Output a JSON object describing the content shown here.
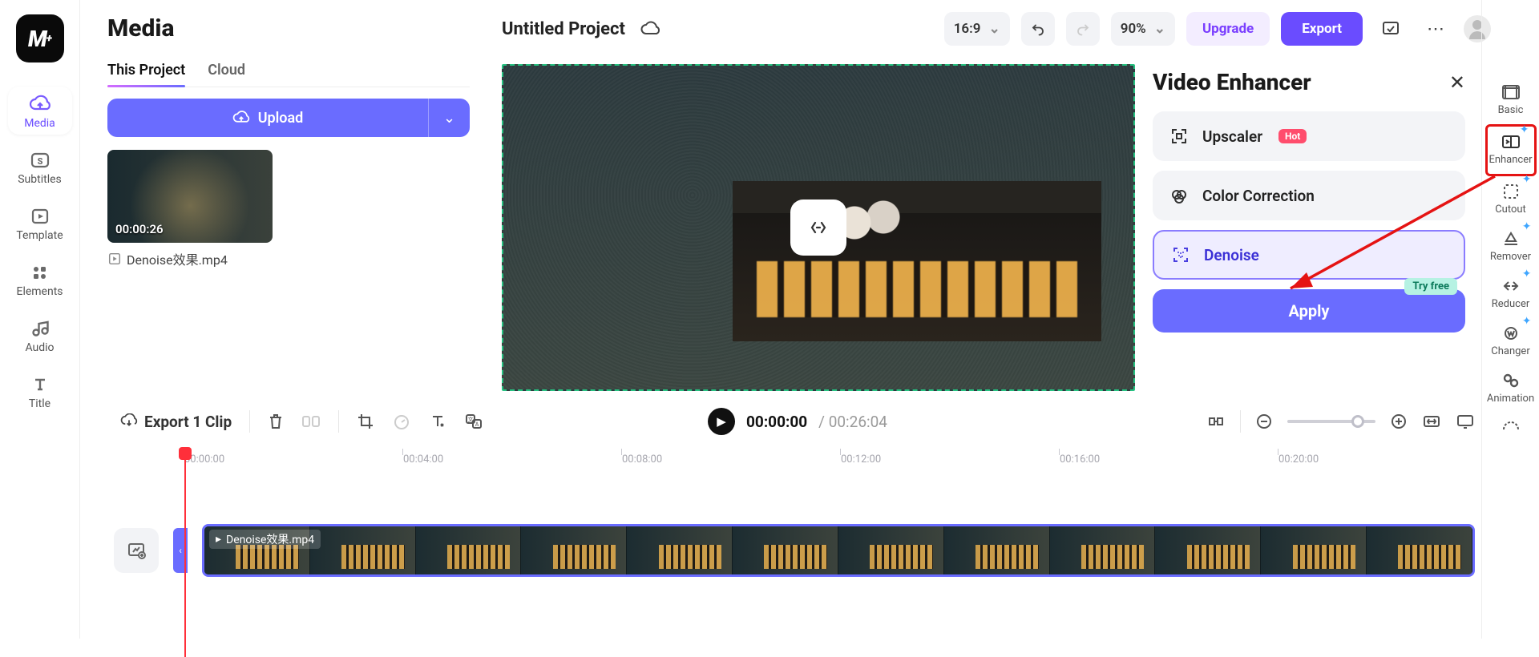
{
  "nav": {
    "items": [
      {
        "label": "Media"
      },
      {
        "label": "Subtitles"
      },
      {
        "label": "Template"
      },
      {
        "label": "Elements"
      },
      {
        "label": "Audio"
      },
      {
        "label": "Title"
      }
    ]
  },
  "mediaPanel": {
    "title": "Media",
    "tabs": {
      "thisProject": "This Project",
      "cloud": "Cloud"
    },
    "uploadLabel": "Upload",
    "clip": {
      "duration": "00:00:26",
      "filename": "Denoise效果.mp4"
    }
  },
  "top": {
    "project": "Untitled Project",
    "aspect": "16:9",
    "zoom": "90%",
    "upgrade": "Upgrade",
    "export": "Export"
  },
  "enhancer": {
    "title": "Video Enhancer",
    "upscaler": "Upscaler",
    "hot": "Hot",
    "color": "Color Correction",
    "denoise": "Denoise",
    "tryfree": "Try free",
    "apply": "Apply"
  },
  "tools": {
    "basic": "Basic",
    "enhancer": "Enhancer",
    "cutout": "Cutout",
    "remover": "Remover",
    "reducer": "Reducer",
    "changer": "Changer",
    "animation": "Animation"
  },
  "playbar": {
    "exportLabel": "Export 1 Clip",
    "tcur": "00:00:00",
    "ttot": "00:26:04"
  },
  "timeline": {
    "ticks": [
      "00:00:00",
      "00:04:00",
      "00:08:00",
      "00:12:00",
      "00:16:00",
      "00:20:00"
    ],
    "clipLabel": "Denoise效果.mp4"
  }
}
